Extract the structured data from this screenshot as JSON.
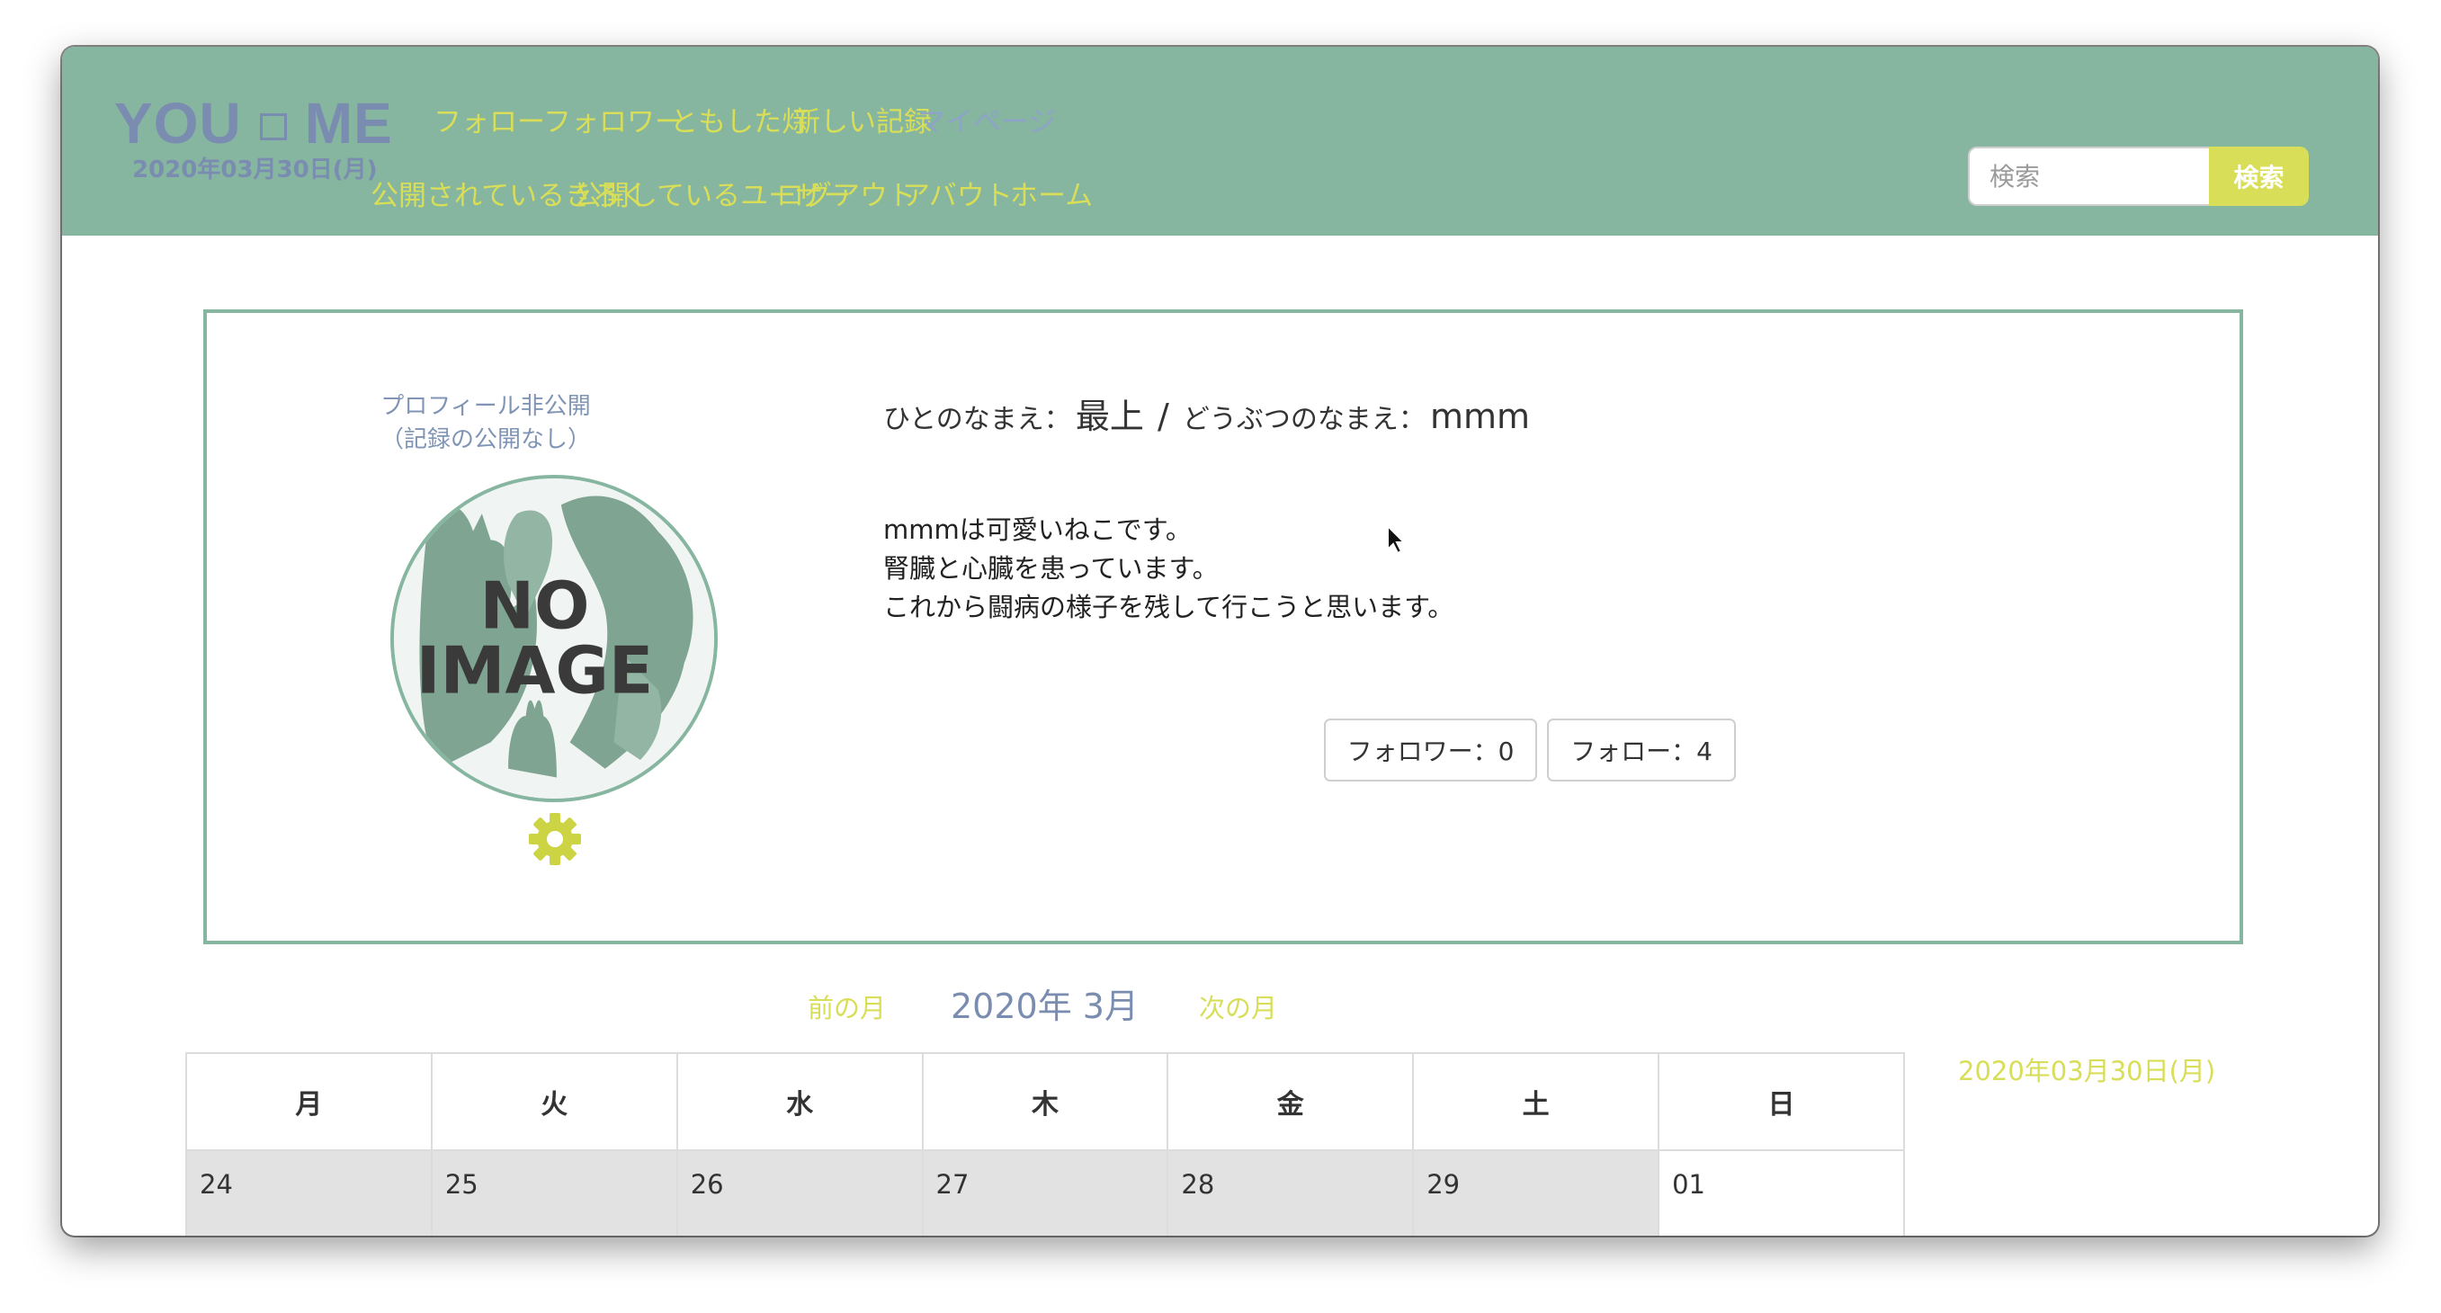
{
  "header": {
    "logo_left": "YOU",
    "logo_right": "ME",
    "date": "2020年03月30日(月)",
    "nav_row1": [
      "フォロー",
      "フォロワー",
      "ともした灯",
      "新しい記録",
      "マイページ"
    ],
    "nav_row2": [
      "公開されているきろく",
      "公開しているユーザー",
      "ログアウト",
      "アバウト",
      "ホーム"
    ],
    "search_placeholder": "検索",
    "search_button": "検索"
  },
  "profile": {
    "private_line1": "プロフィール非公開",
    "private_line2": "（記録の公開なし）",
    "avatar_text_line1": "NO",
    "avatar_text_line2": "IMAGE",
    "person_name_label": "ひとのなまえ：",
    "person_name": "最上",
    "separator": "/",
    "animal_name_label": "どうぶつのなまえ：",
    "animal_name": "mmm",
    "bio": [
      "mmmは可愛いねこです。",
      "腎臓と心臓を患っています。",
      "これから闘病の様子を残して行こうと思います。"
    ],
    "followers_button": "フォロワー：0",
    "following_button": "フォロー：4"
  },
  "calendar": {
    "prev_month": "前の月",
    "title": "2020年 3月",
    "next_month": "次の月",
    "side_date": "2020年03月30日(月)",
    "weekdays": [
      "月",
      "火",
      "水",
      "木",
      "金",
      "土",
      "日"
    ],
    "week1": [
      "24",
      "25",
      "26",
      "27",
      "28",
      "29",
      "01"
    ]
  },
  "colors": {
    "header_bg": "#86b5a0",
    "accent_yellow": "#d8de57",
    "slate_blue": "#7a8db0",
    "card_border": "#86b5a0"
  },
  "icons": {
    "settings": "gear-icon",
    "avatar_placeholder": "no-image-icon"
  }
}
